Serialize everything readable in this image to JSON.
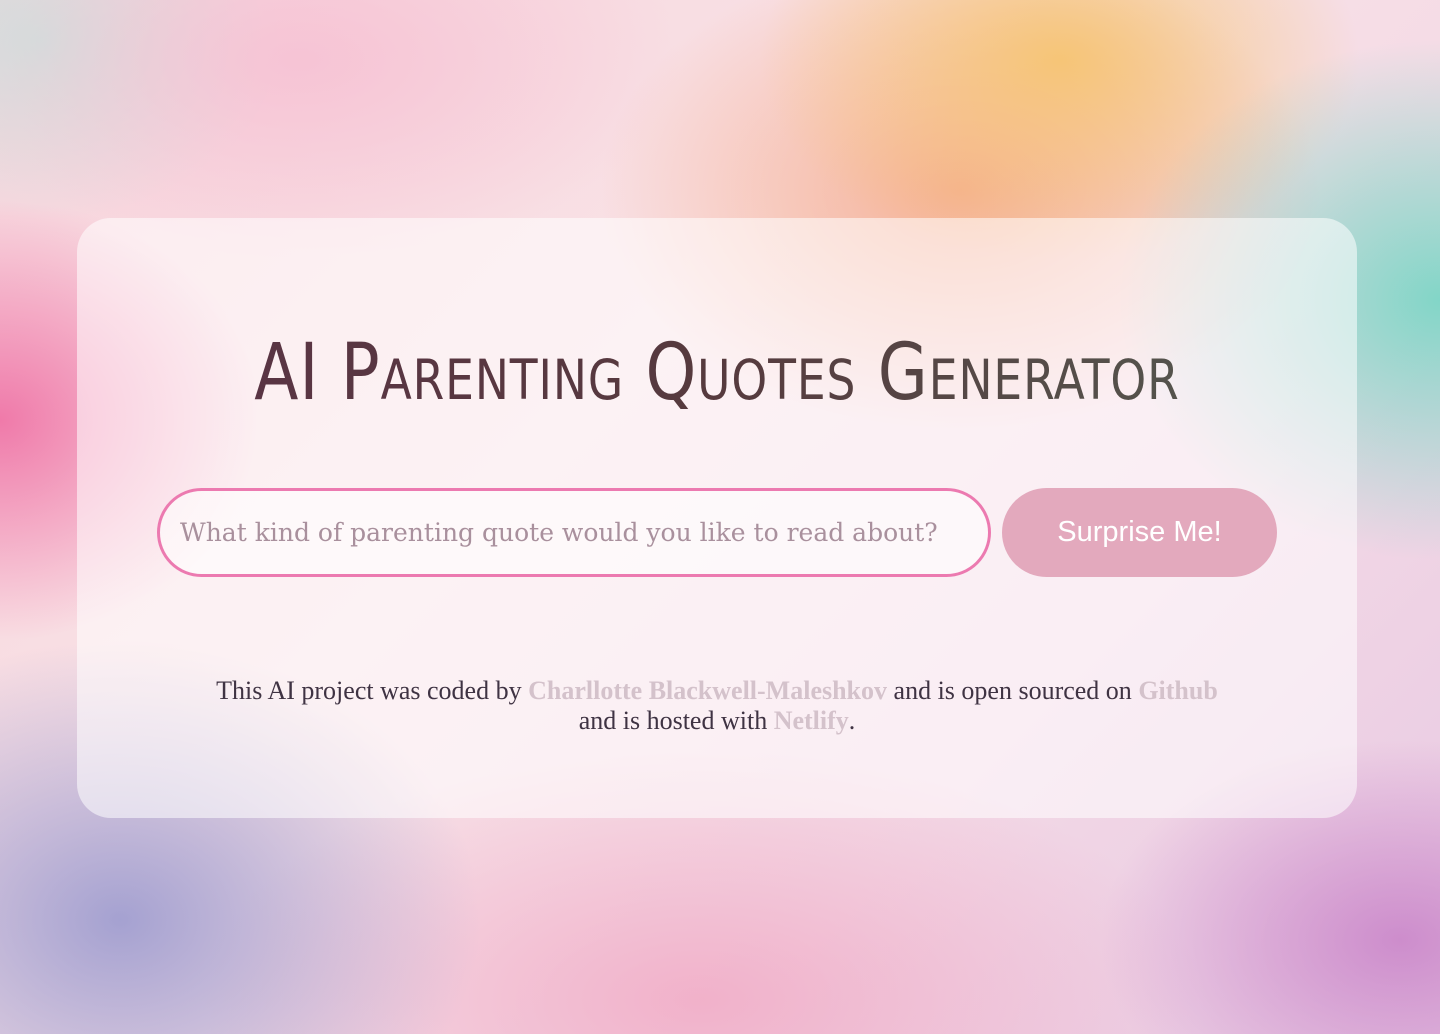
{
  "app": {
    "title": "AI Parenting Quotes Generator"
  },
  "form": {
    "input_placeholder": "What kind of parenting quote would you like to read about?",
    "input_value": "",
    "submit_label": "Surprise Me!"
  },
  "footer": {
    "text_1": "This AI project was coded by ",
    "author_link": "Charllotte Blackwell-Maleshkov",
    "text_2": " and is open sourced on ",
    "github_link": "Github",
    "text_3": "and is hosted with ",
    "netlify_link": "Netlify",
    "text_4": "."
  },
  "colors": {
    "input_border": "#ec7ab0",
    "button_background": "#e3a9bd",
    "link": "#d4c2cb",
    "text": "#3f3343"
  }
}
